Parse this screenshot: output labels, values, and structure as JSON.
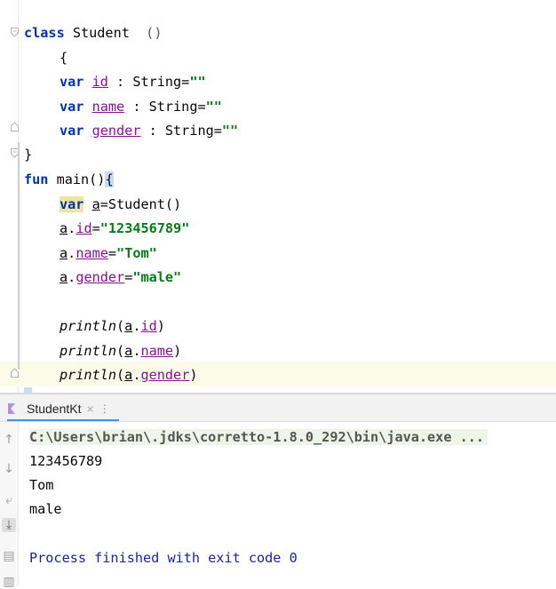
{
  "editor": {
    "class_decl": {
      "kw": "class",
      "name": " Student",
      "parens": "()"
    },
    "open_brace": "{",
    "props": [
      {
        "kw": "var",
        "name": "id",
        "type": " : String=",
        "value": "\"\""
      },
      {
        "kw": "var",
        "name": "name",
        "type": " : String=",
        "value": "\"\""
      },
      {
        "kw": "var",
        "name": "gender",
        "type": " : String=",
        "value": "\"\""
      }
    ],
    "close_brace": "}",
    "fun_decl": {
      "kw": "fun",
      "name": " main()",
      "brace": "{"
    },
    "var_line": {
      "kw": "var",
      "name": "a",
      "rest": "=Student()"
    },
    "assign": [
      {
        "obj": "a",
        "dot": ".",
        "prop": "id",
        "eq": "=",
        "value": "\"123456789\""
      },
      {
        "obj": "a",
        "dot": ".",
        "prop": "name",
        "eq": "=",
        "value": "\"Tom\""
      },
      {
        "obj": "a",
        "dot": ".",
        "prop": "gender",
        "eq": "=",
        "value": "\"male\""
      }
    ],
    "prints": [
      {
        "fn": "println",
        "open": "(",
        "obj": "a",
        "dot": ".",
        "prop": "id",
        "close": ")"
      },
      {
        "fn": "println",
        "open": "(",
        "obj": "a",
        "dot": ".",
        "prop": "name",
        "close": ")"
      },
      {
        "fn": "println",
        "open": "(",
        "obj": "a",
        "dot": ".",
        "prop": "gender",
        "close": ")"
      }
    ],
    "end_brace": "}"
  },
  "run": {
    "tab_label": "StudentKt",
    "tab_close": "×",
    "tab_more": "⋮",
    "command": "C:\\Users\\brian\\.jdks\\corretto-1.8.0_292\\bin\\java.exe ...",
    "output": [
      "123456789",
      "Tom",
      "male"
    ],
    "exit_message": "Process finished with exit code 0"
  },
  "icons": {
    "up": "arrow-up-icon",
    "down": "arrow-down-icon",
    "wrap": "soft-wrap-icon",
    "scroll": "scroll-to-end-icon",
    "print": "print-icon",
    "trash": "trash-icon",
    "run_tab": "kotlin-run-icon"
  },
  "colors": {
    "keyword": "#0033b3",
    "property": "#871094",
    "string": "#067d17",
    "exit": "#1e22a3"
  }
}
